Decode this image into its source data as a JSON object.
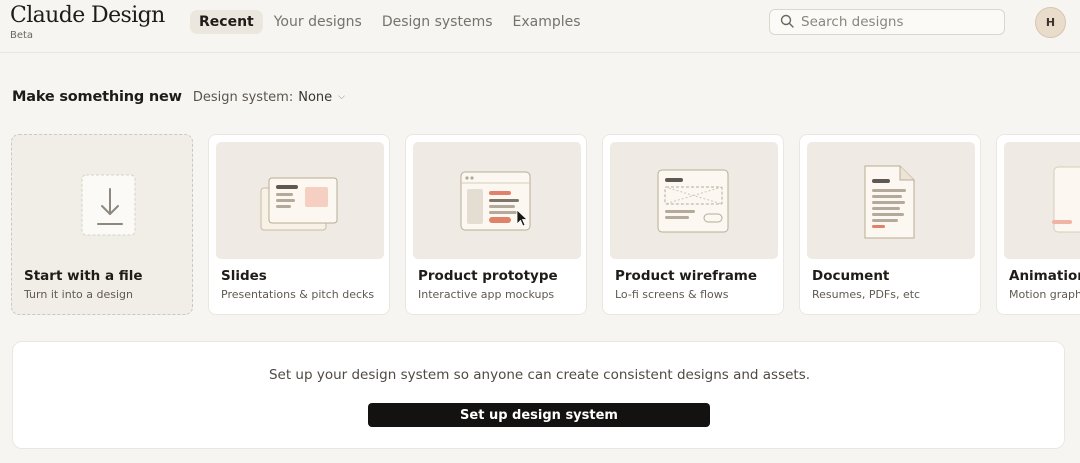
{
  "brand": {
    "title": "Claude Design",
    "badge": "Beta"
  },
  "nav": {
    "tabs": [
      {
        "label": "Recent",
        "active": true
      },
      {
        "label": "Your designs"
      },
      {
        "label": "Design systems"
      },
      {
        "label": "Examples"
      }
    ]
  },
  "search": {
    "placeholder": "Search designs",
    "icon": "search-icon"
  },
  "user": {
    "initial": "H"
  },
  "make": {
    "title": "Make something new",
    "design_system_label": "Design system:",
    "design_system_value": "None"
  },
  "cards": [
    {
      "title": "Start with a file",
      "subtitle": "Turn it into a design",
      "icon": "upload-icon"
    },
    {
      "title": "Slides",
      "subtitle": "Presentations & pitch decks",
      "icon": "slides-illustration"
    },
    {
      "title": "Product prototype",
      "subtitle": "Interactive app mockups",
      "icon": "prototype-illustration"
    },
    {
      "title": "Product wireframe",
      "subtitle": "Lo-fi screens & flows",
      "icon": "wireframe-illustration"
    },
    {
      "title": "Document",
      "subtitle": "Resumes, PDFs, etc",
      "icon": "document-illustration"
    },
    {
      "title": "Animation",
      "subtitle": "Motion graphics",
      "icon": "animation-illustration"
    }
  ],
  "setup": {
    "message": "Set up your design system so anyone can create consistent designs and assets.",
    "button_label": "Set up design system"
  },
  "colors": {
    "accent": "#e0826a",
    "background": "#f7f5f1",
    "button": "#141210"
  }
}
